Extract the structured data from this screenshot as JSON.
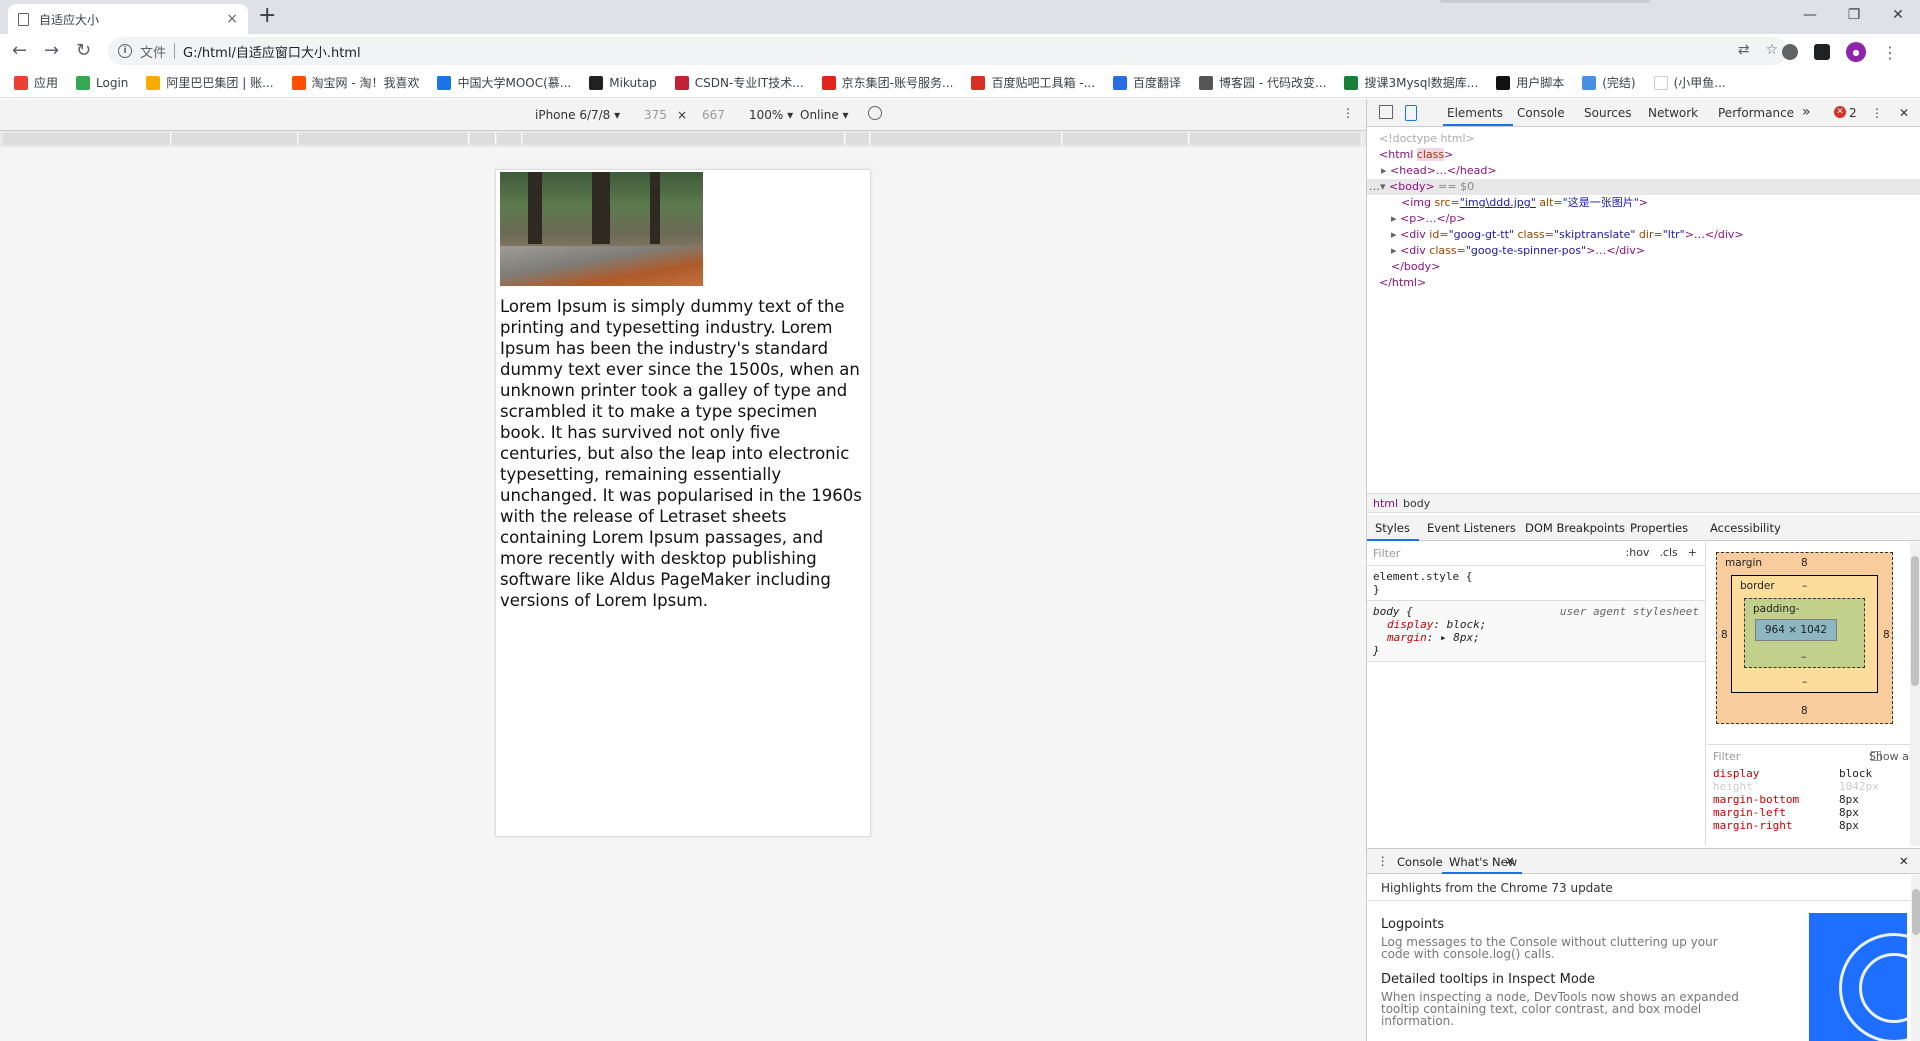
{
  "tab": {
    "title": "自适应大小",
    "close": "×"
  },
  "newtab": "+",
  "window": {
    "minimize": "—",
    "restore": "❐",
    "close": "✕"
  },
  "nav": {
    "back": "←",
    "forward": "→",
    "reload": "↻"
  },
  "address": {
    "scheme_label": "文件",
    "url": "G:/html/自适应窗口大小.html"
  },
  "bookmarks": [
    {
      "label": "应用",
      "color": "#e94235"
    },
    {
      "label": "Login",
      "color": "#34a853"
    },
    {
      "label": "阿里巴巴集团 | 账...",
      "color": "#f9ab00"
    },
    {
      "label": "淘宝网 - 淘！我喜欢",
      "color": "#ff5000"
    },
    {
      "label": "中国大学MOOC(慕...",
      "color": "#1a73e8"
    },
    {
      "label": "Mikutap",
      "color": "#222222"
    },
    {
      "label": "CSDN-专业IT技术...",
      "color": "#c32136"
    },
    {
      "label": "京东集团-账号服务...",
      "color": "#e1251b"
    },
    {
      "label": "百度贴吧工具箱 -...",
      "color": "#d93025"
    },
    {
      "label": "百度翻译",
      "color": "#2b6de5"
    },
    {
      "label": "博客园 - 代码改变...",
      "color": "#555555"
    },
    {
      "label": "搜课3Mysql数据库...",
      "color": "#188038"
    },
    {
      "label": "用户脚本",
      "color": "#111111"
    },
    {
      "label": "(完结)",
      "color": "#4a90e2"
    },
    {
      "label": "(小甲鱼...",
      "color": "#ffffff"
    }
  ],
  "device_toolbar": {
    "device": "iPhone 6/7/8 ▾",
    "width": "375",
    "times": "×",
    "height": "667",
    "zoom": "100% ▾",
    "network": "Online ▾",
    "more": "⋮"
  },
  "page": {
    "image_alt": "这是一张图片",
    "paragraph": "Lorem Ipsum is simply dummy text of the printing and typesetting industry. Lorem Ipsum has been the industry's standard dummy text ever since the 1500s, when an unknown printer took a galley of type and scrambled it to make a type specimen book. It has survived not only five centuries, but also the leap into electronic typesetting, remaining essentially unchanged. It was popularised in the 1960s with the release of Letraset sheets containing Lorem Ipsum passages, and more recently with desktop publishing software like Aldus PageMaker including versions of Lorem Ipsum."
  },
  "devtools": {
    "tabs": [
      "Elements",
      "Console",
      "Sources",
      "Network",
      "Performance"
    ],
    "more_tabs": "»",
    "error_count": "2",
    "dom": {
      "doctype": "<!doctype html>",
      "html_open": "<html",
      "html_attr": "class",
      "head": "<head>…</head>",
      "body_open": "<body>",
      "body_marker": " == $0",
      "img_tag": "<img",
      "img_src_attr": " src=",
      "img_src_val": "\"img\\ddd.jpg\"",
      "img_alt_attr": " alt=",
      "img_alt_val": "\"这是一张图片\"",
      "p_line": "<p>…</p>",
      "div1_open": "<div",
      "div1_id_attr": " id=",
      "div1_id_val": "\"goog-gt-tt\"",
      "div1_class_attr": " class=",
      "div1_class_val": "\"skiptranslate\"",
      "div1_dir_attr": " dir=",
      "div1_dir_val": "\"ltr\"",
      "div1_close": ">…</div>",
      "div2_class_val": "\"goog-te-spinner-pos\"",
      "body_close": "</body>",
      "html_close": "</html>"
    },
    "breadcrumbs": [
      "html",
      "body"
    ],
    "style_tabs": [
      "Styles",
      "Event Listeners",
      "DOM Breakpoints",
      "Properties",
      "Accessibility"
    ],
    "styles_filter_placeholder": "Filter",
    "styles_buttons": {
      "hov": ":hov",
      "cls": ".cls",
      "add": "+"
    },
    "element_style": "element.style {",
    "close_brace": "}",
    "body_rule": {
      "selector": "body {",
      "source": "user agent stylesheet",
      "display_prop": "display",
      "display_val": "block;",
      "margin_prop": "margin",
      "margin_val": "▸ 8px;"
    },
    "box_model": {
      "margin_label": "margin",
      "margin": "8",
      "border_label": "border",
      "border": "–",
      "padding_label": "padding-",
      "padding": "–",
      "content": "964 × 1042"
    },
    "computed_filter": "Filter",
    "show_all": "Show all",
    "computed": [
      {
        "name": "display",
        "value": "block"
      },
      {
        "name": "height",
        "value": "1042px"
      },
      {
        "name": "margin-bottom",
        "value": "8px"
      },
      {
        "name": "margin-left",
        "value": "8px"
      },
      {
        "name": "margin-right",
        "value": "8px"
      }
    ],
    "drawer_tabs": [
      "Console",
      "What's New"
    ],
    "drawer_heading": "Highlights from the Chrome 73 update",
    "whats_new": [
      {
        "title": "Logpoints",
        "desc": "Log messages to the Console without cluttering up your code with console.log() calls."
      },
      {
        "title": "Detailed tooltips in Inspect Mode",
        "desc": "When inspecting a node, DevTools now shows an expanded tooltip containing text, color contrast, and box model information."
      }
    ]
  }
}
